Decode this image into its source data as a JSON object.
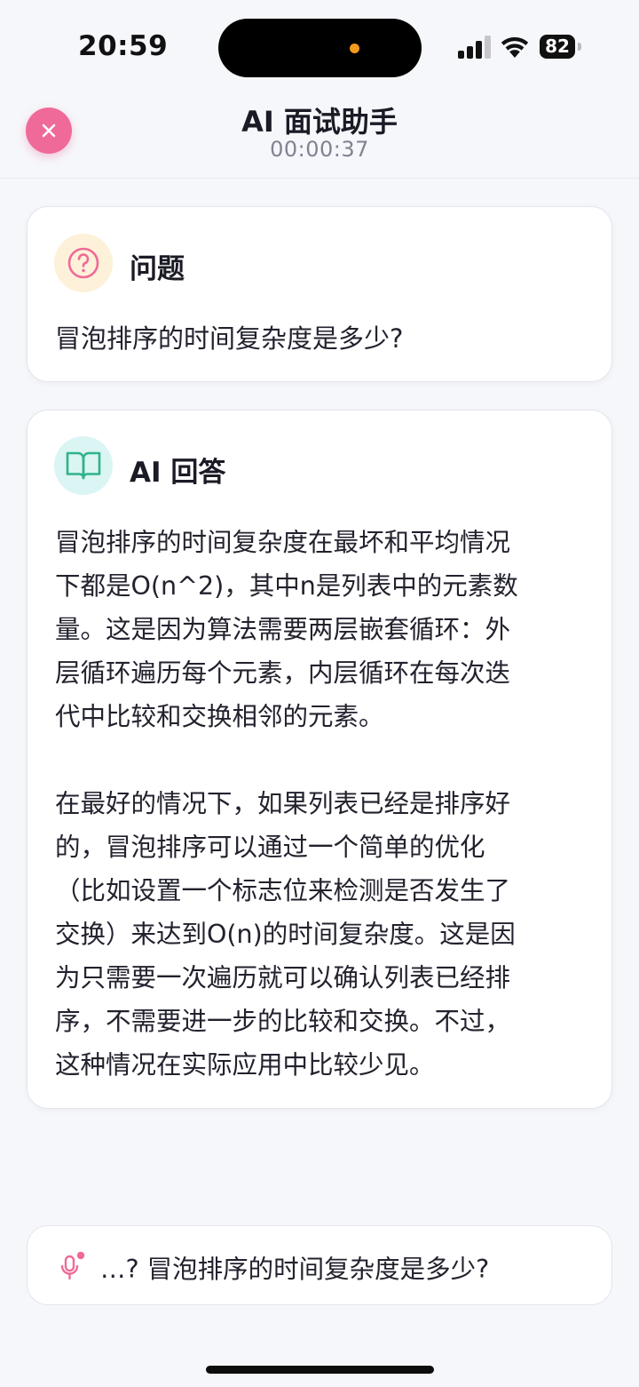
{
  "status_bar": {
    "time": "20:59",
    "battery": "82",
    "island_dot_color": "#f39a1d"
  },
  "header": {
    "title": "AI 面试助手",
    "timer": "00:00:37",
    "close_icon": "close-icon"
  },
  "question_card": {
    "icon": "question-circle-icon",
    "title": "问题",
    "text": "冒泡排序的时间复杂度是多少?"
  },
  "answer_card": {
    "icon": "open-book-icon",
    "title": "AI 回答",
    "paragraphs": [
      "冒泡排序的时间复杂度在最坏和平均情况\n下都是O(n^2)，其中n是列表中的元素数\n量。这是因为算法需要两层嵌套循环：外\n层循环遍历每个元素，内层循环在每次迭\n代中比较和交换相邻的元素。",
      "在最好的情况下，如果列表已经是排序好\n的，冒泡排序可以通过一个简单的优化\n（比如设置一个标志位来检测是否发生了\n交换）来达到O(n)的时间复杂度。这是因\n为只需要一次遍历就可以确认列表已经排\n序，不需要进一步的比较和交换。不过，\n这种情况在实际应用中比较少见。"
    ]
  },
  "transcript": {
    "icon": "microphone-icon",
    "text": "…?  冒泡排序的时间复杂度是多少?"
  },
  "colors": {
    "accent_pink": "#ef6a98",
    "answer_green": "#2fb38a",
    "question_icon_bg": "#fdf1d9",
    "answer_icon_bg": "#dbf4f4"
  }
}
